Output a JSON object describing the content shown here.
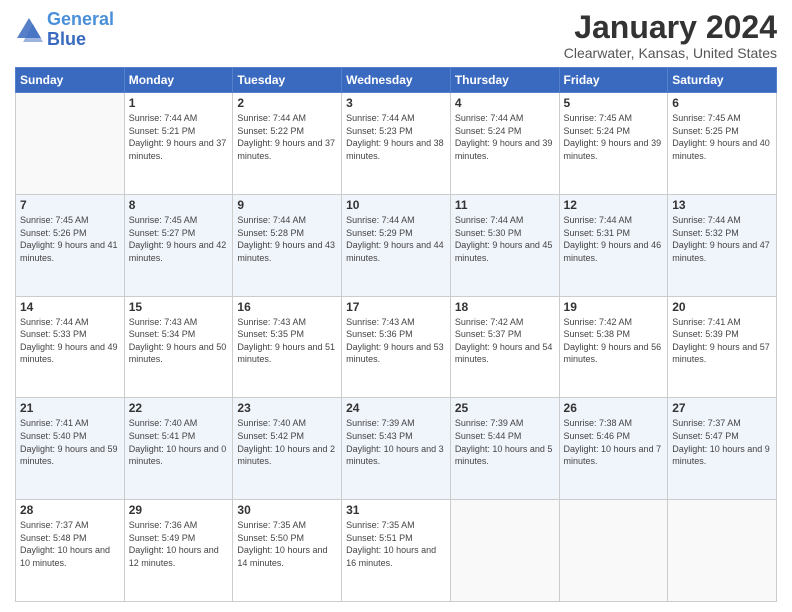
{
  "logo": {
    "line1": "General",
    "line2": "Blue"
  },
  "title": "January 2024",
  "location": "Clearwater, Kansas, United States",
  "days_of_week": [
    "Sunday",
    "Monday",
    "Tuesday",
    "Wednesday",
    "Thursday",
    "Friday",
    "Saturday"
  ],
  "weeks": [
    [
      {
        "num": "",
        "sunrise": "",
        "sunset": "",
        "daylight": ""
      },
      {
        "num": "1",
        "sunrise": "Sunrise: 7:44 AM",
        "sunset": "Sunset: 5:21 PM",
        "daylight": "Daylight: 9 hours and 37 minutes."
      },
      {
        "num": "2",
        "sunrise": "Sunrise: 7:44 AM",
        "sunset": "Sunset: 5:22 PM",
        "daylight": "Daylight: 9 hours and 37 minutes."
      },
      {
        "num": "3",
        "sunrise": "Sunrise: 7:44 AM",
        "sunset": "Sunset: 5:23 PM",
        "daylight": "Daylight: 9 hours and 38 minutes."
      },
      {
        "num": "4",
        "sunrise": "Sunrise: 7:44 AM",
        "sunset": "Sunset: 5:24 PM",
        "daylight": "Daylight: 9 hours and 39 minutes."
      },
      {
        "num": "5",
        "sunrise": "Sunrise: 7:45 AM",
        "sunset": "Sunset: 5:24 PM",
        "daylight": "Daylight: 9 hours and 39 minutes."
      },
      {
        "num": "6",
        "sunrise": "Sunrise: 7:45 AM",
        "sunset": "Sunset: 5:25 PM",
        "daylight": "Daylight: 9 hours and 40 minutes."
      }
    ],
    [
      {
        "num": "7",
        "sunrise": "Sunrise: 7:45 AM",
        "sunset": "Sunset: 5:26 PM",
        "daylight": "Daylight: 9 hours and 41 minutes."
      },
      {
        "num": "8",
        "sunrise": "Sunrise: 7:45 AM",
        "sunset": "Sunset: 5:27 PM",
        "daylight": "Daylight: 9 hours and 42 minutes."
      },
      {
        "num": "9",
        "sunrise": "Sunrise: 7:44 AM",
        "sunset": "Sunset: 5:28 PM",
        "daylight": "Daylight: 9 hours and 43 minutes."
      },
      {
        "num": "10",
        "sunrise": "Sunrise: 7:44 AM",
        "sunset": "Sunset: 5:29 PM",
        "daylight": "Daylight: 9 hours and 44 minutes."
      },
      {
        "num": "11",
        "sunrise": "Sunrise: 7:44 AM",
        "sunset": "Sunset: 5:30 PM",
        "daylight": "Daylight: 9 hours and 45 minutes."
      },
      {
        "num": "12",
        "sunrise": "Sunrise: 7:44 AM",
        "sunset": "Sunset: 5:31 PM",
        "daylight": "Daylight: 9 hours and 46 minutes."
      },
      {
        "num": "13",
        "sunrise": "Sunrise: 7:44 AM",
        "sunset": "Sunset: 5:32 PM",
        "daylight": "Daylight: 9 hours and 47 minutes."
      }
    ],
    [
      {
        "num": "14",
        "sunrise": "Sunrise: 7:44 AM",
        "sunset": "Sunset: 5:33 PM",
        "daylight": "Daylight: 9 hours and 49 minutes."
      },
      {
        "num": "15",
        "sunrise": "Sunrise: 7:43 AM",
        "sunset": "Sunset: 5:34 PM",
        "daylight": "Daylight: 9 hours and 50 minutes."
      },
      {
        "num": "16",
        "sunrise": "Sunrise: 7:43 AM",
        "sunset": "Sunset: 5:35 PM",
        "daylight": "Daylight: 9 hours and 51 minutes."
      },
      {
        "num": "17",
        "sunrise": "Sunrise: 7:43 AM",
        "sunset": "Sunset: 5:36 PM",
        "daylight": "Daylight: 9 hours and 53 minutes."
      },
      {
        "num": "18",
        "sunrise": "Sunrise: 7:42 AM",
        "sunset": "Sunset: 5:37 PM",
        "daylight": "Daylight: 9 hours and 54 minutes."
      },
      {
        "num": "19",
        "sunrise": "Sunrise: 7:42 AM",
        "sunset": "Sunset: 5:38 PM",
        "daylight": "Daylight: 9 hours and 56 minutes."
      },
      {
        "num": "20",
        "sunrise": "Sunrise: 7:41 AM",
        "sunset": "Sunset: 5:39 PM",
        "daylight": "Daylight: 9 hours and 57 minutes."
      }
    ],
    [
      {
        "num": "21",
        "sunrise": "Sunrise: 7:41 AM",
        "sunset": "Sunset: 5:40 PM",
        "daylight": "Daylight: 9 hours and 59 minutes."
      },
      {
        "num": "22",
        "sunrise": "Sunrise: 7:40 AM",
        "sunset": "Sunset: 5:41 PM",
        "daylight": "Daylight: 10 hours and 0 minutes."
      },
      {
        "num": "23",
        "sunrise": "Sunrise: 7:40 AM",
        "sunset": "Sunset: 5:42 PM",
        "daylight": "Daylight: 10 hours and 2 minutes."
      },
      {
        "num": "24",
        "sunrise": "Sunrise: 7:39 AM",
        "sunset": "Sunset: 5:43 PM",
        "daylight": "Daylight: 10 hours and 3 minutes."
      },
      {
        "num": "25",
        "sunrise": "Sunrise: 7:39 AM",
        "sunset": "Sunset: 5:44 PM",
        "daylight": "Daylight: 10 hours and 5 minutes."
      },
      {
        "num": "26",
        "sunrise": "Sunrise: 7:38 AM",
        "sunset": "Sunset: 5:46 PM",
        "daylight": "Daylight: 10 hours and 7 minutes."
      },
      {
        "num": "27",
        "sunrise": "Sunrise: 7:37 AM",
        "sunset": "Sunset: 5:47 PM",
        "daylight": "Daylight: 10 hours and 9 minutes."
      }
    ],
    [
      {
        "num": "28",
        "sunrise": "Sunrise: 7:37 AM",
        "sunset": "Sunset: 5:48 PM",
        "daylight": "Daylight: 10 hours and 10 minutes."
      },
      {
        "num": "29",
        "sunrise": "Sunrise: 7:36 AM",
        "sunset": "Sunset: 5:49 PM",
        "daylight": "Daylight: 10 hours and 12 minutes."
      },
      {
        "num": "30",
        "sunrise": "Sunrise: 7:35 AM",
        "sunset": "Sunset: 5:50 PM",
        "daylight": "Daylight: 10 hours and 14 minutes."
      },
      {
        "num": "31",
        "sunrise": "Sunrise: 7:35 AM",
        "sunset": "Sunset: 5:51 PM",
        "daylight": "Daylight: 10 hours and 16 minutes."
      },
      {
        "num": "",
        "sunrise": "",
        "sunset": "",
        "daylight": ""
      },
      {
        "num": "",
        "sunrise": "",
        "sunset": "",
        "daylight": ""
      },
      {
        "num": "",
        "sunrise": "",
        "sunset": "",
        "daylight": ""
      }
    ]
  ]
}
